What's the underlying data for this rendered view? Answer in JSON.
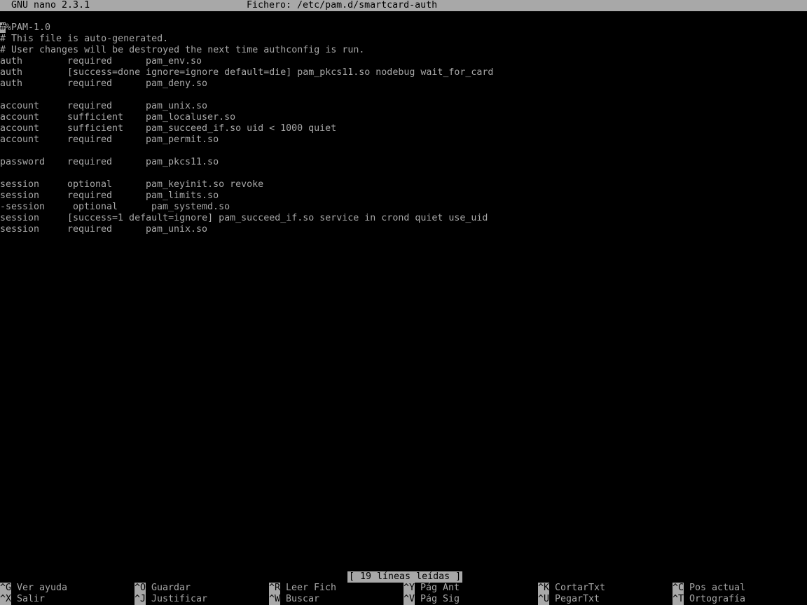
{
  "titlebar": {
    "app": "GNU nano 2.3.1",
    "file": "Fichero: /etc/pam.d/smartcard-auth"
  },
  "cursor_char": "#",
  "lines": [
    {
      "type": "text",
      "text": "%PAM-1.0"
    },
    {
      "type": "text",
      "text": "# This file is auto-generated."
    },
    {
      "type": "text",
      "text": "# User changes will be destroyed the next time authconfig is run."
    },
    {
      "type": "rule",
      "a": "auth",
      "b": "required",
      "c": "pam_env.so"
    },
    {
      "type": "rule",
      "a": "auth",
      "b": "[success=done ignore=ignore default=die] pam_pkcs11.so nodebug wait_for_card",
      "c": ""
    },
    {
      "type": "rule",
      "a": "auth",
      "b": "required",
      "c": "pam_deny.so"
    },
    {
      "type": "blank"
    },
    {
      "type": "rule",
      "a": "account",
      "b": "required",
      "c": "pam_unix.so"
    },
    {
      "type": "rule",
      "a": "account",
      "b": "sufficient",
      "c": "pam_localuser.so"
    },
    {
      "type": "rule",
      "a": "account",
      "b": "sufficient",
      "c": "pam_succeed_if.so uid < 1000 quiet"
    },
    {
      "type": "rule",
      "a": "account",
      "b": "required",
      "c": "pam_permit.so"
    },
    {
      "type": "blank"
    },
    {
      "type": "rule",
      "a": "password",
      "b": "required",
      "c": "pam_pkcs11.so"
    },
    {
      "type": "blank"
    },
    {
      "type": "rule",
      "a": "session",
      "b": "optional",
      "c": "pam_keyinit.so revoke"
    },
    {
      "type": "rule",
      "a": "session",
      "b": "required",
      "c": "pam_limits.so"
    },
    {
      "type": "rule2",
      "a": "-session",
      "b": "optional",
      "c": "pam_systemd.so"
    },
    {
      "type": "rule",
      "a": "session",
      "b": "[success=1 default=ignore] pam_succeed_if.so service in crond quiet use_uid",
      "c": ""
    },
    {
      "type": "rule",
      "a": "session",
      "b": "required",
      "c": "pam_unix.so"
    }
  ],
  "status": "[ 19 líneas leídas ]",
  "shortcuts": [
    {
      "key": "^G",
      "label": "Ver ayuda"
    },
    {
      "key": "^O",
      "label": "Guardar"
    },
    {
      "key": "^R",
      "label": "Leer Fich"
    },
    {
      "key": "^Y",
      "label": "Pág Ant"
    },
    {
      "key": "^K",
      "label": "CortarTxt"
    },
    {
      "key": "^C",
      "label": "Pos actual"
    },
    {
      "key": "^X",
      "label": "Salir"
    },
    {
      "key": "^J",
      "label": "Justificar"
    },
    {
      "key": "^W",
      "label": "Buscar"
    },
    {
      "key": "^V",
      "label": "Pág Sig"
    },
    {
      "key": "^U",
      "label": "PegarTxt"
    },
    {
      "key": "^T",
      "label": "Ortografía"
    }
  ],
  "colors": {
    "background": "#000000",
    "foreground": "#a8a8a8",
    "inverse_bg": "#a8a8a8",
    "inverse_fg": "#000000"
  }
}
